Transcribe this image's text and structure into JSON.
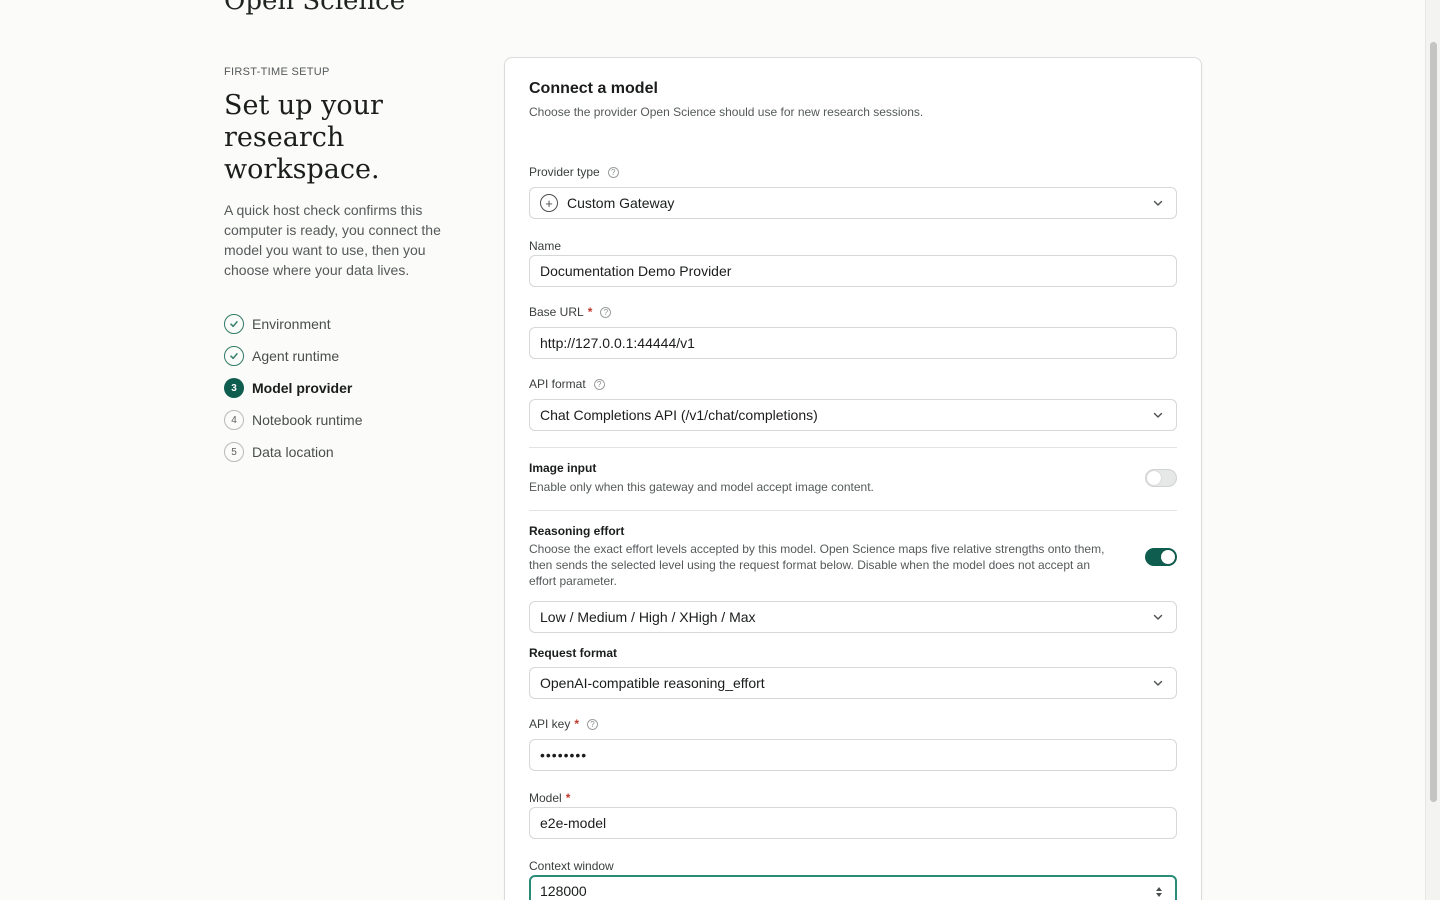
{
  "app": {
    "brand": "Open Science"
  },
  "intro": {
    "eyebrow": "FIRST-TIME SETUP",
    "headline": "Set up your research workspace.",
    "lede": "A quick host check confirms this computer is ready, you connect the model you want to use, then you choose where your data lives."
  },
  "steps": [
    {
      "label": "Environment",
      "status": "done",
      "marker": "✓"
    },
    {
      "label": "Agent runtime",
      "status": "done",
      "marker": "✓"
    },
    {
      "label": "Model provider",
      "status": "current",
      "marker": "3"
    },
    {
      "label": "Notebook runtime",
      "status": "todo",
      "marker": "4"
    },
    {
      "label": "Data location",
      "status": "todo",
      "marker": "5"
    }
  ],
  "card": {
    "title": "Connect a model",
    "subtitle": "Choose the provider Open Science should use for new research sessions."
  },
  "form": {
    "provider_type": {
      "label": "Provider type",
      "value": "Custom Gateway",
      "icon": "plus-circle-icon"
    },
    "name": {
      "label": "Name",
      "value": "Documentation Demo Provider"
    },
    "base_url": {
      "label": "Base URL",
      "required": "*",
      "value": "http://127.0.0.1:44444/v1"
    },
    "api_format": {
      "label": "API format",
      "value": "Chat Completions API (/v1/chat/completions)"
    },
    "image_input": {
      "title": "Image input",
      "description": "Enable only when this gateway and model accept image content.",
      "enabled": false
    },
    "reasoning_effort": {
      "title": "Reasoning effort",
      "description": "Choose the exact effort levels accepted by this model. Open Science maps five relative strengths onto them, then sends the selected level using the request format below. Disable when the model does not accept an effort parameter.",
      "enabled": true,
      "levels_value": "Low / Medium / High / XHigh / Max"
    },
    "request_format": {
      "label": "Request format",
      "value": "OpenAI-compatible reasoning_effort"
    },
    "api_key": {
      "label": "API key",
      "required": "*",
      "value": "••••••••"
    },
    "model": {
      "label": "Model",
      "required": "*",
      "value": "e2e-model"
    },
    "context_window": {
      "label": "Context window",
      "value": "128000"
    }
  },
  "colors": {
    "accent": "#0f5d4f",
    "focus": "#2a8c78",
    "required": "#c0392b"
  }
}
